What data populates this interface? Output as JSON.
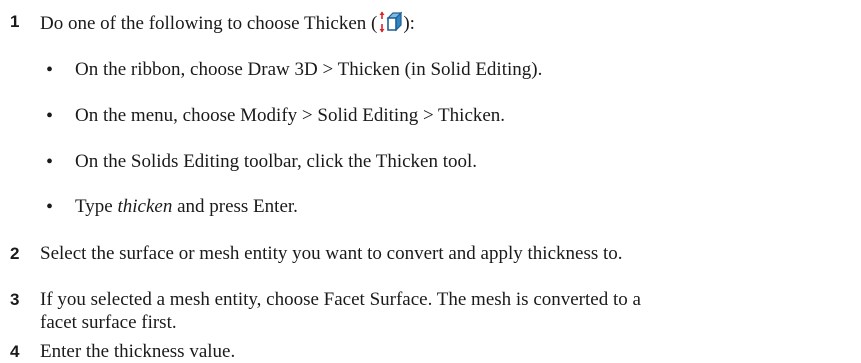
{
  "steps": [
    {
      "number": "1",
      "text_before_icon": "Do one of the following to choose Thicken (",
      "icon_name": "thicken-icon",
      "text_after_icon": "):",
      "options": [
        "On the ribbon, choose Draw 3D > Thicken (in Solid Editing).",
        "On the menu, choose Modify > Solid Editing > Thicken.",
        "On the Solids Editing toolbar, click the Thicken tool."
      ],
      "type_option": {
        "prefix": "Type ",
        "command": "thicken",
        "suffix": " and press Enter."
      }
    },
    {
      "number": "2",
      "text": "Select the surface or mesh entity you want to convert and apply thickness to."
    },
    {
      "number": "3",
      "text_line1": "If you selected a mesh entity, choose Facet Surface. The mesh is converted to a",
      "text_line2": "facet surface first."
    },
    {
      "number": "4",
      "text": "Enter the thickness value."
    }
  ],
  "bullet_char": "•",
  "colors": {
    "icon_arrow": "#d9262b",
    "icon_body": "#2f86c4",
    "text": "#1a1a1a"
  }
}
